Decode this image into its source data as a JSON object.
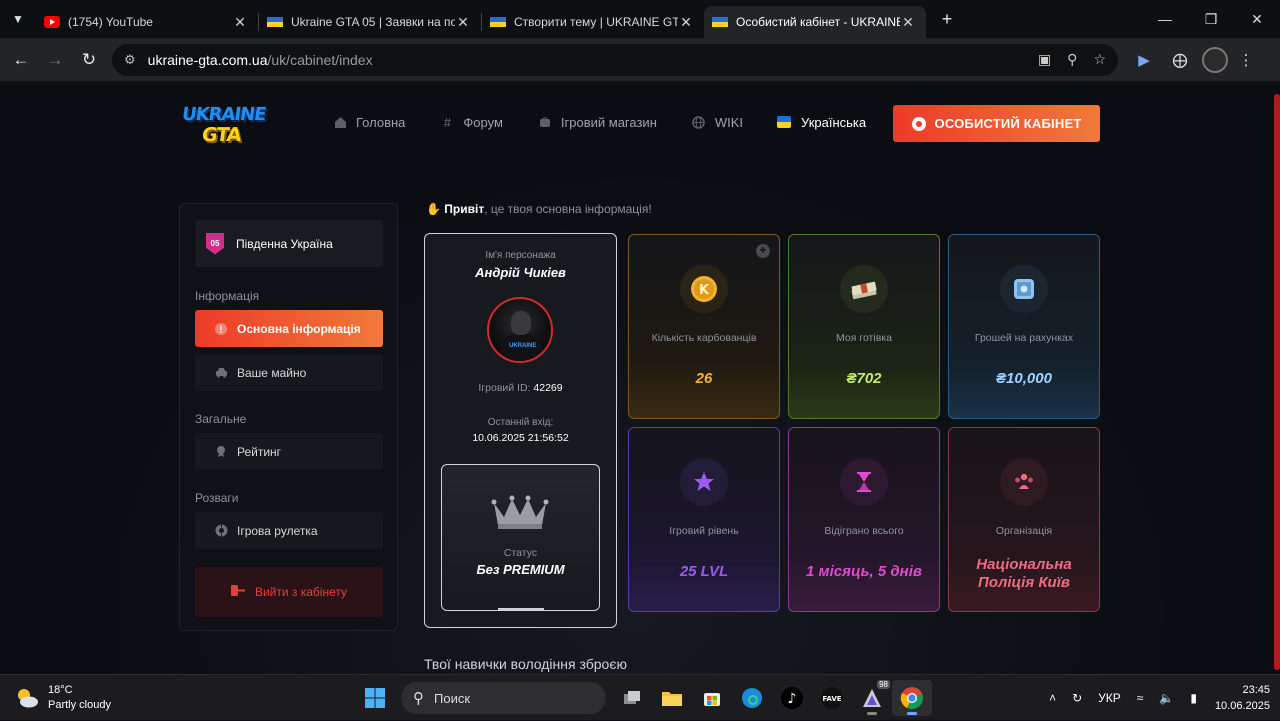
{
  "browser": {
    "tabs": [
      {
        "title": "(1754) YouTube",
        "icon": "youtube-icon",
        "active": false
      },
      {
        "title": "Ukraine GTA 05 | Заявки на пос",
        "icon": "site-favicon",
        "active": false
      },
      {
        "title": "Створити тему | UKRAINE GTA",
        "icon": "site-favicon",
        "active": false
      },
      {
        "title": "Особистий кабінет - UKRAINE",
        "icon": "site-favicon",
        "active": true
      }
    ],
    "url_host": "ukraine-gta.com.ua",
    "url_path": "/uk/cabinet/index"
  },
  "site": {
    "logo_line1": "UKRAINE",
    "logo_line2": "GTA",
    "nav": [
      {
        "label": "Головна",
        "icon": "home-icon"
      },
      {
        "label": "Форум",
        "icon": "hash-icon"
      },
      {
        "label": "Ігровий магазин",
        "icon": "shop-bag-icon"
      },
      {
        "label": "WIKI",
        "icon": "globe-icon"
      }
    ],
    "language": "Українська",
    "cabinet_button": "ОСОБИСТИЙ КАБІНЕТ"
  },
  "sidebar": {
    "server_badge": "05",
    "server_name": "Південна Україна",
    "section_info": "Інформація",
    "item_main_info": "Основна інформація",
    "item_property": "Ваше майно",
    "section_general": "Загальне",
    "item_rating": "Рейтинг",
    "section_fun": "Розваги",
    "item_roulette": "Ігрова рулетка",
    "logout": "Вийти з кабінету"
  },
  "main": {
    "greeting_bold": "Привіт",
    "greeting_rest": ", це твоя основна інформація!",
    "character": {
      "name_label": "Ім'я персонажа",
      "name": "Андрій Чикіев",
      "id_label": "Ігровий ID:",
      "id": "42269",
      "last_login_label": "Останній вхід:",
      "last_login": "10.06.2025 21:56:52",
      "status_label": "Статус",
      "status": "Без PREMIUM"
    },
    "stats": [
      {
        "label": "Кількість карбованців",
        "value": "26",
        "color": "#f2b233"
      },
      {
        "label": "Моя готівка",
        "value": "₴702",
        "color": "#c6ea6a"
      },
      {
        "label": "Грошей на рахунках",
        "value": "₴10,000",
        "color": "#9fd3ff"
      },
      {
        "label": "Ігровий рівень",
        "value": "25 LVL",
        "color": "#9a5cf0"
      },
      {
        "label": "Відіграно всього",
        "value": "1 місяць, 5 днів",
        "color": "#e04bd0"
      },
      {
        "label": "Організація",
        "value": "Національна Поліція Київ",
        "value_line1": "Національна",
        "value_line2": "Поліція Київ",
        "color": "#f06a84"
      }
    ],
    "skills_title": "Твої навички володіння зброєю"
  },
  "taskbar": {
    "temp": "18°C",
    "weather": "Partly cloudy",
    "search_placeholder": "Поиск",
    "lang": "УКР",
    "time": "23:45",
    "date": "10.06.2025",
    "badge": "98"
  }
}
